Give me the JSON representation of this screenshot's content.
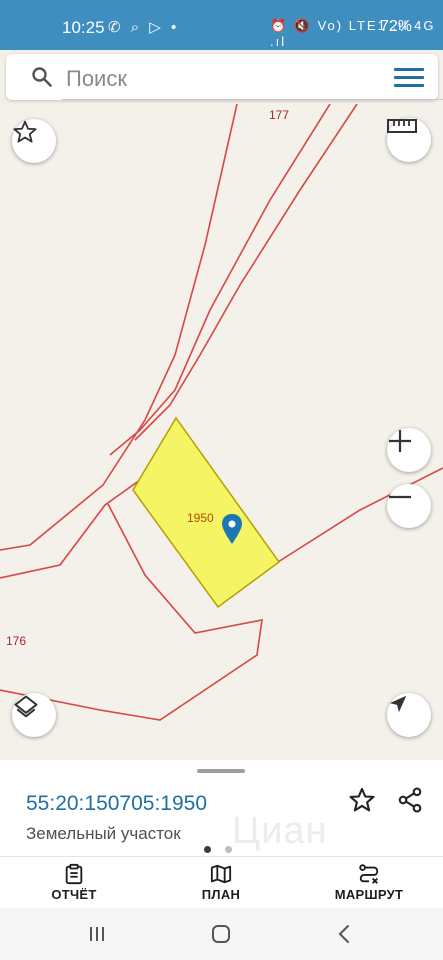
{
  "status_bar": {
    "time": "10:25",
    "left_icons": "✆ ⌕ ▷ •",
    "right_icons": "⏰ 🔇 Vo) LTE1 .ıl 4G .ıl",
    "battery": "72%"
  },
  "search": {
    "placeholder": "Поиск"
  },
  "map": {
    "labels": {
      "top": "177",
      "left": "176"
    },
    "parcel": {
      "area_label": "1950",
      "fill_color": "#f4f464",
      "border_color": "#b6a000"
    },
    "boundary_color": "#d84646",
    "marker_color": "#1a79b5"
  },
  "bottom_sheet": {
    "cadastral_number": "55:20:150705:1950",
    "subtitle": "Земельный участок",
    "watermark": "Циан",
    "pager_active_color": "#3a3a3a",
    "pager_inactive_color": "#bdbdbd"
  },
  "actions": [
    {
      "label": "ОТЧЁТ",
      "icon": "clipboard-icon"
    },
    {
      "label": "ПЛАН",
      "icon": "map-icon"
    },
    {
      "label": "МАРШРУТ",
      "icon": "route-icon"
    }
  ],
  "colors": {
    "statusbar_bg": "#3f8ec0",
    "accent": "#1f6fa3"
  }
}
